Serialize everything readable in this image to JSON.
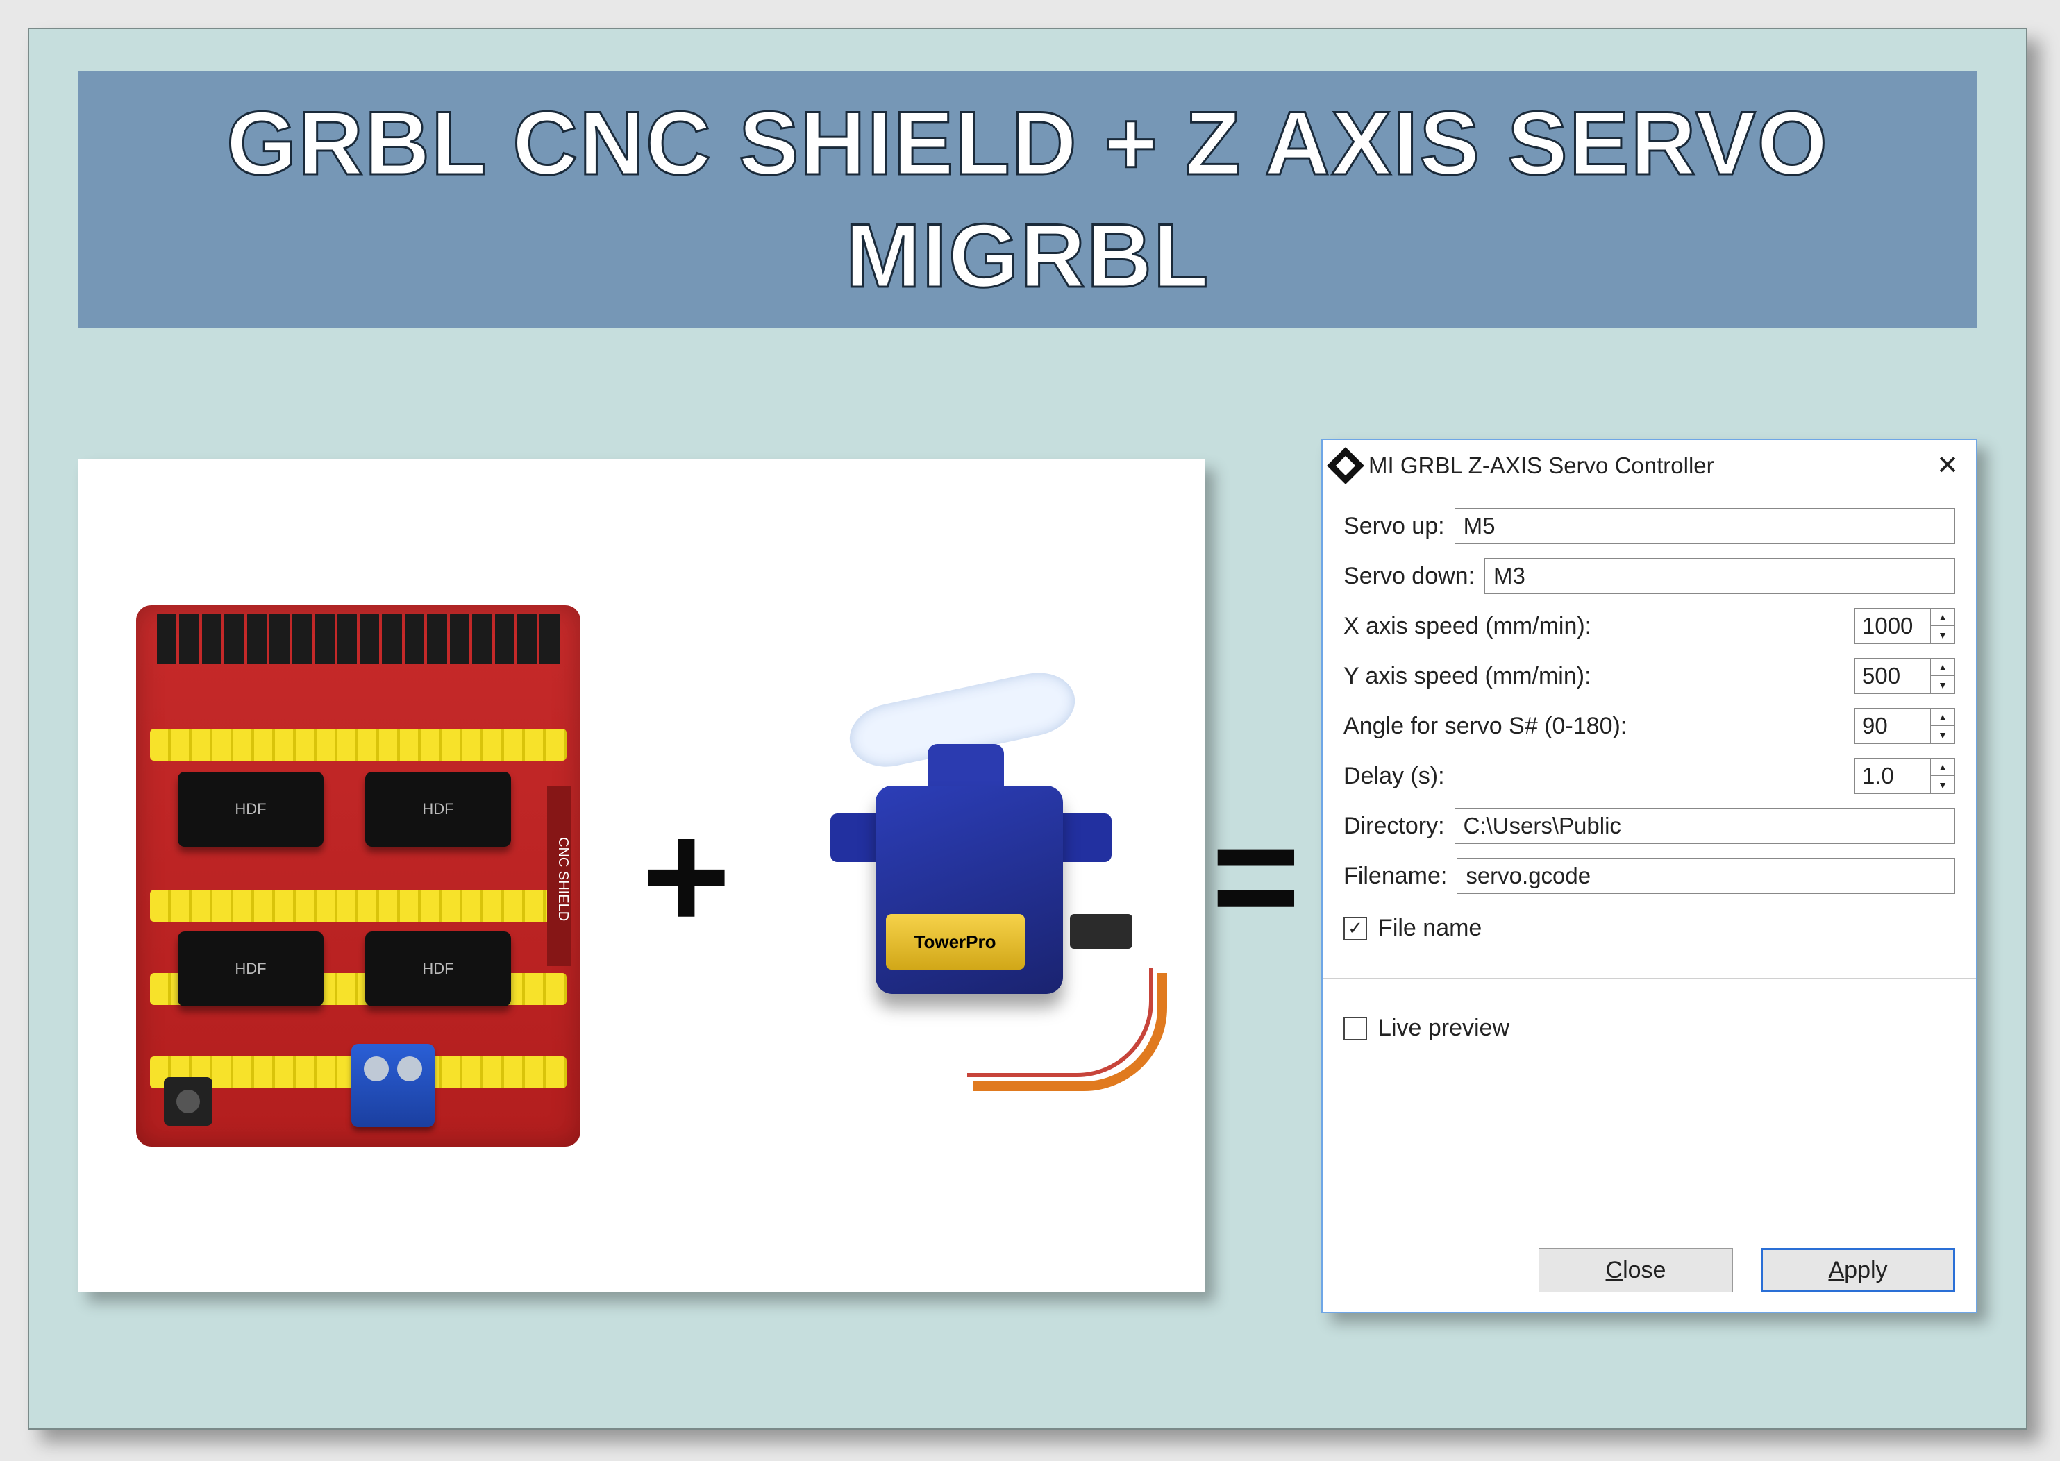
{
  "banner": {
    "title": "GRBL CNC SHIELD + Z AXIS SERVO MIGRBL"
  },
  "illustration": {
    "plus_symbol": "+",
    "equals_symbol": "=",
    "cnc_caps": [
      "HDF",
      "HDF",
      "HDF",
      "HDF"
    ],
    "cnc_side_label": "CNC SHIELD",
    "servo_label": "TowerPro"
  },
  "dialog": {
    "icon_name": "inkscape-icon",
    "title": "MI GRBL Z-AXIS Servo Controller",
    "close_glyph": "✕",
    "fields": {
      "servo_up": {
        "label": "Servo up:",
        "value": "M5"
      },
      "servo_down": {
        "label": "Servo down:",
        "value": "M3"
      },
      "x_speed": {
        "label": "X axis speed (mm/min):",
        "value": "1000"
      },
      "y_speed": {
        "label": "Y axis speed (mm/min):",
        "value": "500"
      },
      "angle": {
        "label": "Angle for servo S# (0-180):",
        "value": "90"
      },
      "delay": {
        "label": "Delay (s):",
        "value": "1.0"
      },
      "directory": {
        "label": "Directory:",
        "value": "C:\\Users\\Public"
      },
      "filename": {
        "label": "Filename:",
        "value": "servo.gcode"
      }
    },
    "checkboxes": {
      "file_name": {
        "label": "File name",
        "checked": true
      },
      "live_preview": {
        "label": "Live preview",
        "checked": false
      }
    },
    "buttons": {
      "close": "Close",
      "apply": "Apply"
    },
    "spinner": {
      "up": "▲",
      "down": "▼"
    },
    "check_glyph": "✓"
  }
}
